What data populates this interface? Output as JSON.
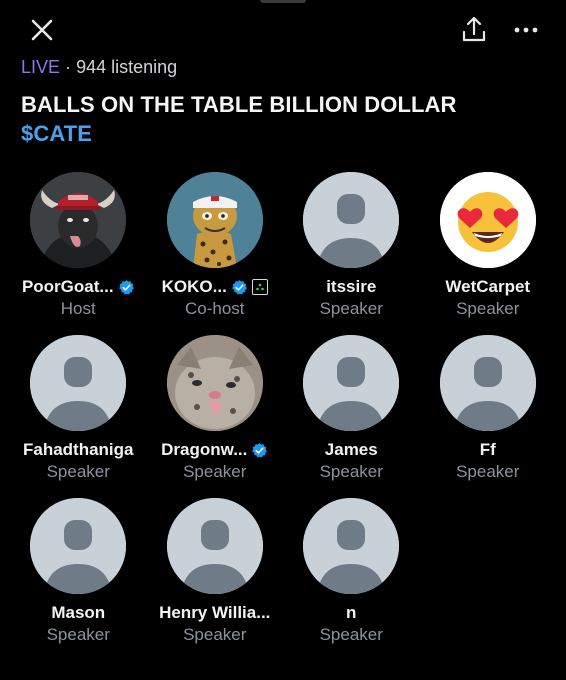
{
  "header": {
    "live_label": "LIVE",
    "separator": "·",
    "listening": "944 listening",
    "title_line1": "BALLS ON THE TABLE BILLION DOLLAR",
    "title_line2": "$CATE"
  },
  "icons": {
    "close": "close-icon",
    "share": "share-icon",
    "more": "more-icon",
    "verified": "verified-badge-icon"
  },
  "colors": {
    "live": "#8b76f0",
    "title_accent": "#4aa2ee",
    "verified": "#1d9bf0",
    "placeholder_avatar": "#c9d1d8"
  },
  "participants": [
    {
      "name": "PoorGoat...",
      "role": "Host",
      "verified": true
    },
    {
      "name": "KOKO...",
      "role": "Co-host",
      "verified": true
    },
    {
      "name": "itssire",
      "role": "Speaker",
      "verified": false
    },
    {
      "name": "WetCarpet",
      "role": "Speaker",
      "verified": false
    },
    {
      "name": "Fahadthaniga",
      "role": "Speaker",
      "verified": false
    },
    {
      "name": "Dragonw...",
      "role": "Speaker",
      "verified": true
    },
    {
      "name": "James",
      "role": "Speaker",
      "verified": false
    },
    {
      "name": "Ff",
      "role": "Speaker",
      "verified": false
    },
    {
      "name": "Mason",
      "role": "Speaker",
      "verified": false
    },
    {
      "name": "Henry Willia...",
      "role": "Speaker",
      "verified": false
    },
    {
      "name": "n",
      "role": "Speaker",
      "verified": false
    }
  ]
}
